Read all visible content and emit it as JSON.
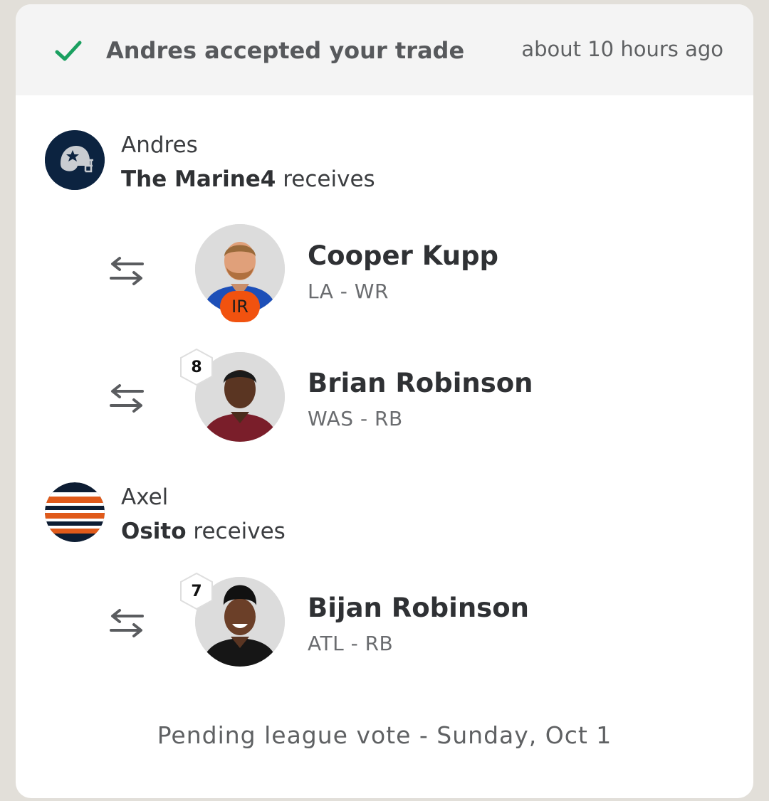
{
  "trade_card": {
    "header": {
      "status_icon": "check-icon",
      "title": "Andres accepted your trade",
      "time": "about 10 hours ago",
      "accent_color": "#1aa060"
    },
    "teams": [
      {
        "owner": "Andres",
        "team_name": "The Marine4",
        "receives_label": " receives",
        "logo": "helmet-logo",
        "players": [
          {
            "name": "Cooper Kupp",
            "position": "LA - WR",
            "status_badge": "IR",
            "transfer_icon": "swap-arrows-icon"
          },
          {
            "name": "Brian Robinson",
            "position": "WAS - RB",
            "rank_badge": "8",
            "transfer_icon": "swap-arrows-icon"
          }
        ]
      },
      {
        "owner": "Axel",
        "team_name": "Osito",
        "receives_label": " receives",
        "logo": "striped-logo",
        "players": [
          {
            "name": "Bijan Robinson",
            "position": "ATL - RB",
            "rank_badge": "7",
            "transfer_icon": "swap-arrows-icon"
          }
        ]
      }
    ],
    "footer": {
      "status": "Pending league vote - Sunday, Oct 1"
    }
  }
}
